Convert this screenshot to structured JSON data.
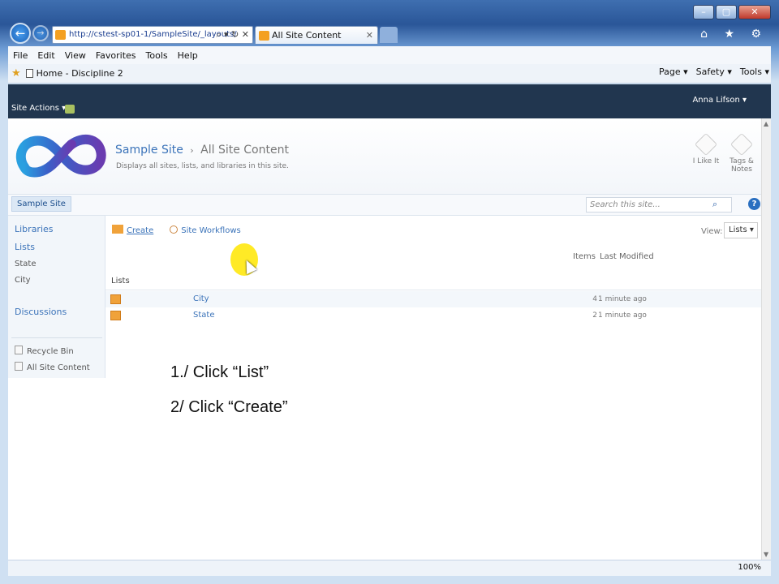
{
  "browser": {
    "address": "http://cstest-sp01-1/SampleSite/_layouts/",
    "address_controls": "⌕ ▾ ↻ ✕",
    "tab_title": "All Site Content",
    "tab_close": "✕",
    "window_controls": [
      "–",
      "▢",
      "✕"
    ],
    "right_icons": "⌂ ★ ⚙",
    "menu": [
      "File",
      "Edit",
      "View",
      "Favorites",
      "Tools",
      "Help"
    ],
    "favorites_item": "Home - Discipline 2",
    "command_bar": [
      "Page ▾",
      "Safety ▾",
      "Tools ▾"
    ],
    "zoom": "100%"
  },
  "sharepoint": {
    "site_actions": "Site Actions ▾",
    "user": "Anna Lifson ▾",
    "breadcrumb_site": "Sample Site",
    "breadcrumb_sep": "›",
    "breadcrumb_current": "All Site Content",
    "description": "Displays all sites, lists, and libraries in this site.",
    "i_like_it": "I Like It",
    "tags_notes": "Tags & Notes",
    "top_nav_selected": "Sample Site",
    "search_placeholder": "Search this site...",
    "help": "?"
  },
  "quick_launch": {
    "libraries": "Libraries",
    "lists": "Lists",
    "list_items": [
      "State",
      "City"
    ],
    "discussions": "Discussions",
    "recycle_bin": "Recycle Bin",
    "all_site_content": "All Site Content"
  },
  "toolbar": {
    "create": "Create",
    "site_workflows": "Site Workflows",
    "view_label": "View:",
    "view_value": "Lists ▾"
  },
  "table": {
    "col_items": "Items",
    "col_modified": "Last Modified",
    "group": "Lists",
    "rows": [
      {
        "name": "City",
        "items": "4",
        "modified": "1 minute ago"
      },
      {
        "name": "State",
        "items": "2",
        "modified": "1 minute ago"
      }
    ]
  },
  "instructions": [
    "1./ Click “List”",
    "2/ Click “Create”"
  ],
  "colors": {
    "suite_bar": "#21364f",
    "link_blue": "#3b73b9",
    "list_icon": "#f0a23a",
    "highlight": "#ffe600"
  }
}
